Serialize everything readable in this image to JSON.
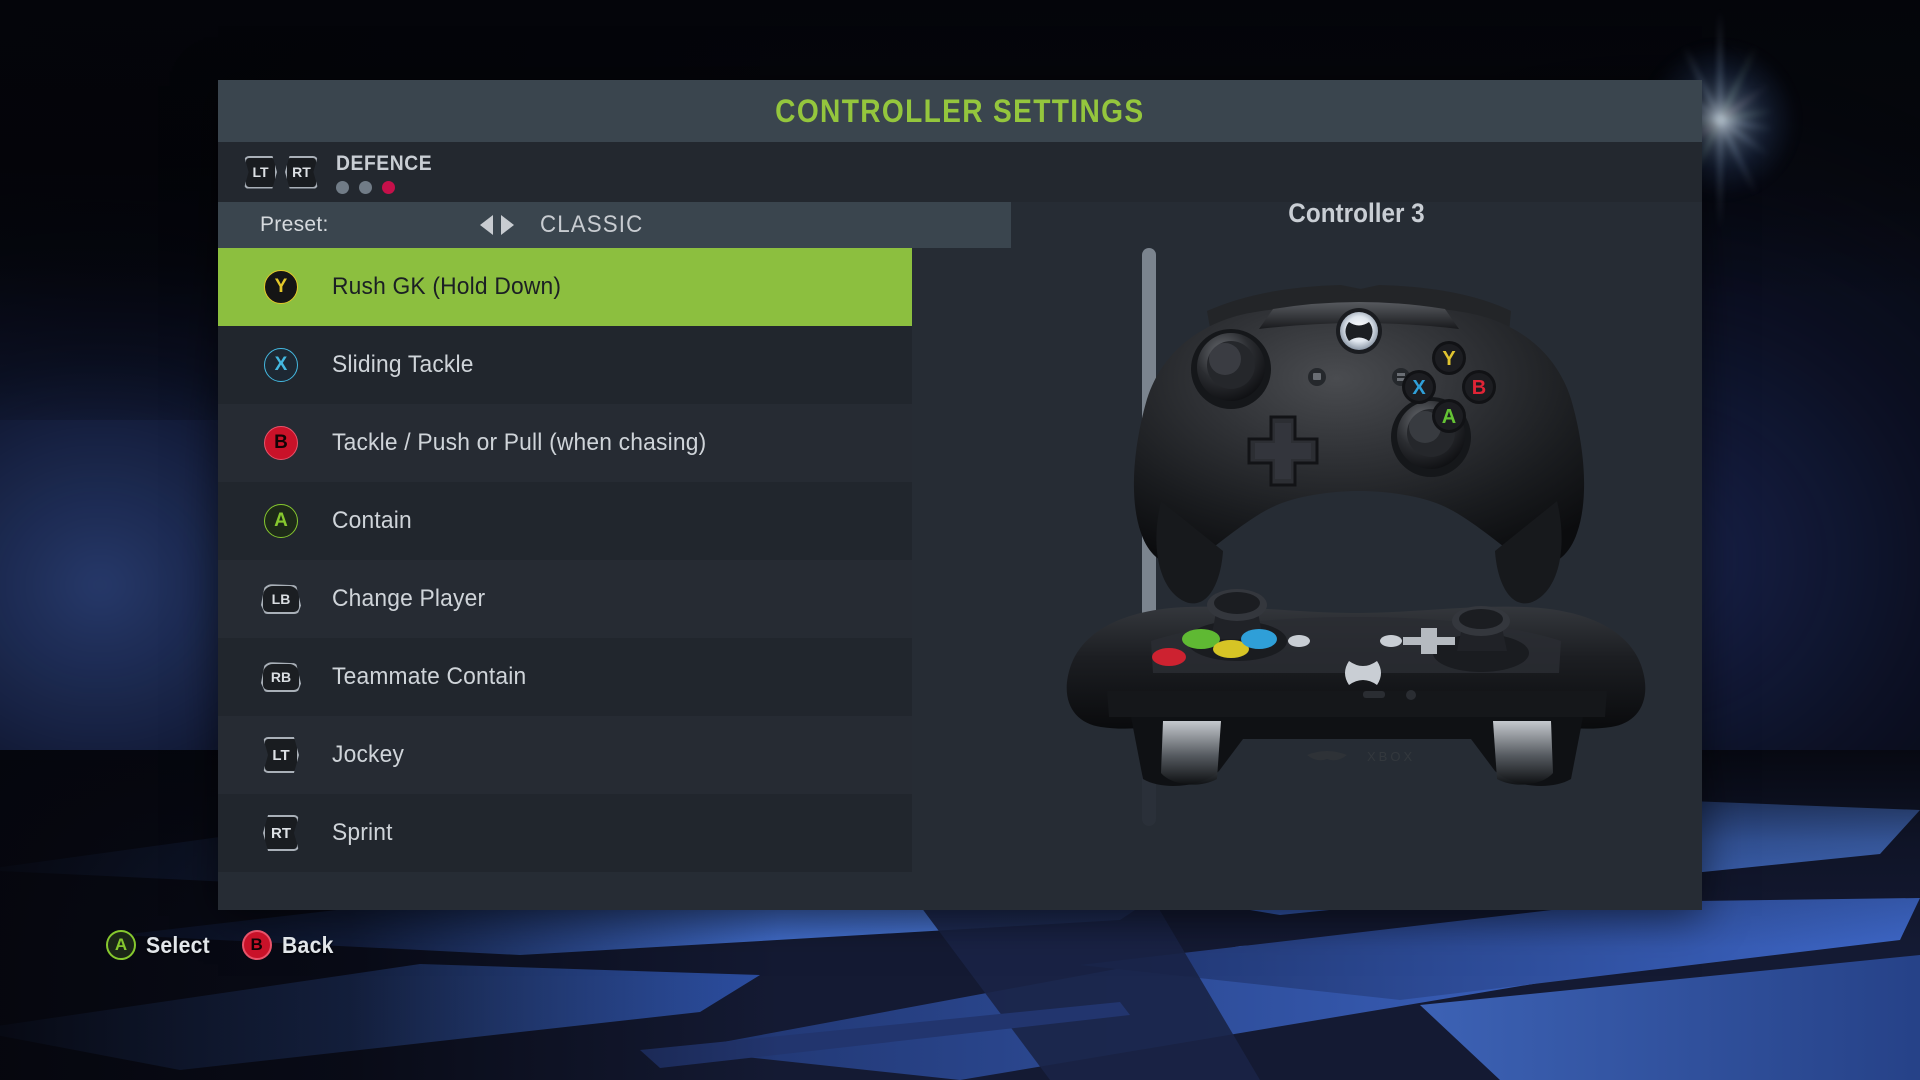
{
  "window": {
    "title": "CONTROLLER SETTINGS",
    "title_color": "#94c63d"
  },
  "tabs": {
    "left_trigger_icon": "LT",
    "right_trigger_icon": "RT",
    "current_label": "DEFENCE",
    "page_count": 3,
    "active_page_index": 2,
    "active_dot_color": "#c5104a",
    "inactive_dot_color": "#717c87"
  },
  "preset": {
    "label": "Preset:",
    "value": "CLASSIC",
    "prev_arrow": "left-arrow-icon",
    "next_arrow": "right-arrow-icon"
  },
  "bindings": {
    "selected_index": 0,
    "selected_color": "#8cbf3f",
    "rows": [
      {
        "button": "Y",
        "button_type": "face",
        "label": "Rush GK (Hold Down)"
      },
      {
        "button": "X",
        "button_type": "face",
        "label": "Sliding Tackle"
      },
      {
        "button": "B",
        "button_type": "face",
        "label": "Tackle / Push or Pull (when chasing)"
      },
      {
        "button": "A",
        "button_type": "face",
        "label": "Contain"
      },
      {
        "button": "LB",
        "button_type": "bumper",
        "label": "Change Player"
      },
      {
        "button": "RB",
        "button_type": "bumper",
        "label": "Teammate Contain"
      },
      {
        "button": "LT",
        "button_type": "trigger",
        "label": "Jockey"
      },
      {
        "button": "RT",
        "button_type": "trigger",
        "label": "Sprint"
      }
    ]
  },
  "scrollbar": {
    "thumb_position_percent": 0,
    "thumb_size_percent": 80
  },
  "right_pane": {
    "controller_label": "Controller 3",
    "controller_image": "xbox-one-controller",
    "face_buttons": [
      {
        "letter": "Y",
        "color": "#e0c430"
      },
      {
        "letter": "X",
        "color": "#2f9fd8"
      },
      {
        "letter": "B",
        "color": "#e02436"
      },
      {
        "letter": "A",
        "color": "#64c334"
      }
    ]
  },
  "footer": {
    "actions": [
      {
        "button": "A",
        "label": "Select"
      },
      {
        "button": "B",
        "label": "Back"
      }
    ]
  }
}
